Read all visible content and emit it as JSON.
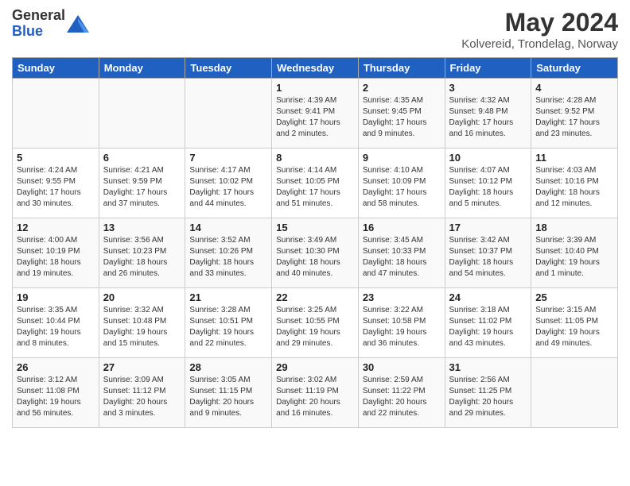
{
  "app": {
    "name_general": "General",
    "name_blue": "Blue"
  },
  "header": {
    "month_title": "May 2024",
    "location": "Kolvereid, Trondelag, Norway"
  },
  "days_of_week": [
    "Sunday",
    "Monday",
    "Tuesday",
    "Wednesday",
    "Thursday",
    "Friday",
    "Saturday"
  ],
  "weeks": [
    [
      {
        "day": "",
        "info": ""
      },
      {
        "day": "",
        "info": ""
      },
      {
        "day": "",
        "info": ""
      },
      {
        "day": "1",
        "info": "Sunrise: 4:39 AM\nSunset: 9:41 PM\nDaylight: 17 hours and 2 minutes."
      },
      {
        "day": "2",
        "info": "Sunrise: 4:35 AM\nSunset: 9:45 PM\nDaylight: 17 hours and 9 minutes."
      },
      {
        "day": "3",
        "info": "Sunrise: 4:32 AM\nSunset: 9:48 PM\nDaylight: 17 hours and 16 minutes."
      },
      {
        "day": "4",
        "info": "Sunrise: 4:28 AM\nSunset: 9:52 PM\nDaylight: 17 hours and 23 minutes."
      }
    ],
    [
      {
        "day": "5",
        "info": "Sunrise: 4:24 AM\nSunset: 9:55 PM\nDaylight: 17 hours and 30 minutes."
      },
      {
        "day": "6",
        "info": "Sunrise: 4:21 AM\nSunset: 9:59 PM\nDaylight: 17 hours and 37 minutes."
      },
      {
        "day": "7",
        "info": "Sunrise: 4:17 AM\nSunset: 10:02 PM\nDaylight: 17 hours and 44 minutes."
      },
      {
        "day": "8",
        "info": "Sunrise: 4:14 AM\nSunset: 10:05 PM\nDaylight: 17 hours and 51 minutes."
      },
      {
        "day": "9",
        "info": "Sunrise: 4:10 AM\nSunset: 10:09 PM\nDaylight: 17 hours and 58 minutes."
      },
      {
        "day": "10",
        "info": "Sunrise: 4:07 AM\nSunset: 10:12 PM\nDaylight: 18 hours and 5 minutes."
      },
      {
        "day": "11",
        "info": "Sunrise: 4:03 AM\nSunset: 10:16 PM\nDaylight: 18 hours and 12 minutes."
      }
    ],
    [
      {
        "day": "12",
        "info": "Sunrise: 4:00 AM\nSunset: 10:19 PM\nDaylight: 18 hours and 19 minutes."
      },
      {
        "day": "13",
        "info": "Sunrise: 3:56 AM\nSunset: 10:23 PM\nDaylight: 18 hours and 26 minutes."
      },
      {
        "day": "14",
        "info": "Sunrise: 3:52 AM\nSunset: 10:26 PM\nDaylight: 18 hours and 33 minutes."
      },
      {
        "day": "15",
        "info": "Sunrise: 3:49 AM\nSunset: 10:30 PM\nDaylight: 18 hours and 40 minutes."
      },
      {
        "day": "16",
        "info": "Sunrise: 3:45 AM\nSunset: 10:33 PM\nDaylight: 18 hours and 47 minutes."
      },
      {
        "day": "17",
        "info": "Sunrise: 3:42 AM\nSunset: 10:37 PM\nDaylight: 18 hours and 54 minutes."
      },
      {
        "day": "18",
        "info": "Sunrise: 3:39 AM\nSunset: 10:40 PM\nDaylight: 19 hours and 1 minute."
      }
    ],
    [
      {
        "day": "19",
        "info": "Sunrise: 3:35 AM\nSunset: 10:44 PM\nDaylight: 19 hours and 8 minutes."
      },
      {
        "day": "20",
        "info": "Sunrise: 3:32 AM\nSunset: 10:48 PM\nDaylight: 19 hours and 15 minutes."
      },
      {
        "day": "21",
        "info": "Sunrise: 3:28 AM\nSunset: 10:51 PM\nDaylight: 19 hours and 22 minutes."
      },
      {
        "day": "22",
        "info": "Sunrise: 3:25 AM\nSunset: 10:55 PM\nDaylight: 19 hours and 29 minutes."
      },
      {
        "day": "23",
        "info": "Sunrise: 3:22 AM\nSunset: 10:58 PM\nDaylight: 19 hours and 36 minutes."
      },
      {
        "day": "24",
        "info": "Sunrise: 3:18 AM\nSunset: 11:02 PM\nDaylight: 19 hours and 43 minutes."
      },
      {
        "day": "25",
        "info": "Sunrise: 3:15 AM\nSunset: 11:05 PM\nDaylight: 19 hours and 49 minutes."
      }
    ],
    [
      {
        "day": "26",
        "info": "Sunrise: 3:12 AM\nSunset: 11:08 PM\nDaylight: 19 hours and 56 minutes."
      },
      {
        "day": "27",
        "info": "Sunrise: 3:09 AM\nSunset: 11:12 PM\nDaylight: 20 hours and 3 minutes."
      },
      {
        "day": "28",
        "info": "Sunrise: 3:05 AM\nSunset: 11:15 PM\nDaylight: 20 hours and 9 minutes."
      },
      {
        "day": "29",
        "info": "Sunrise: 3:02 AM\nSunset: 11:19 PM\nDaylight: 20 hours and 16 minutes."
      },
      {
        "day": "30",
        "info": "Sunrise: 2:59 AM\nSunset: 11:22 PM\nDaylight: 20 hours and 22 minutes."
      },
      {
        "day": "31",
        "info": "Sunrise: 2:56 AM\nSunset: 11:25 PM\nDaylight: 20 hours and 29 minutes."
      },
      {
        "day": "",
        "info": ""
      }
    ]
  ]
}
